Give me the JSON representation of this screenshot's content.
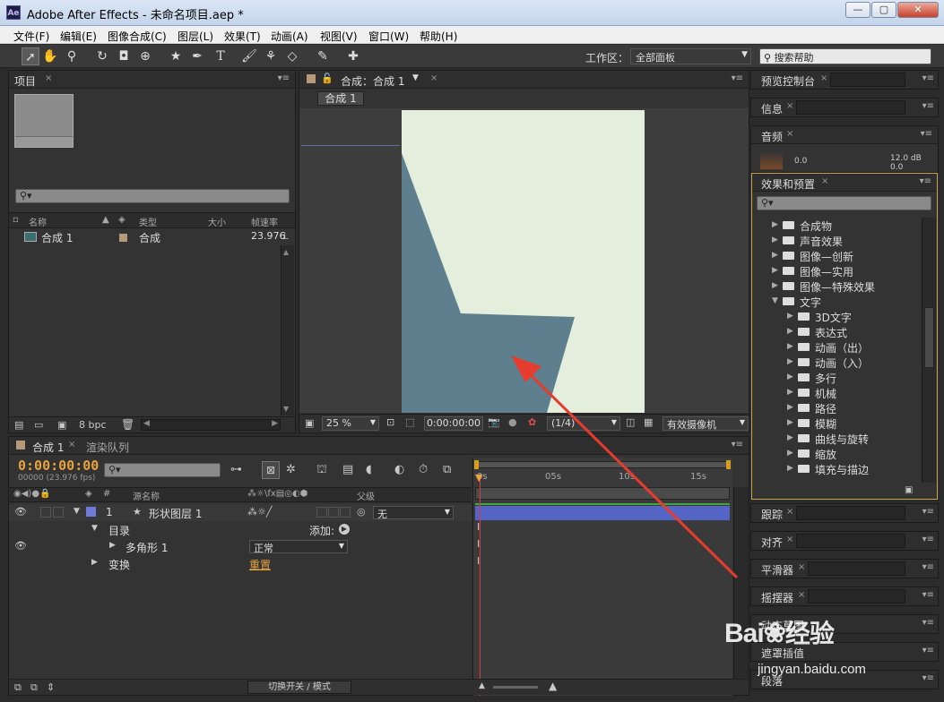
{
  "app": {
    "title": "Adobe After Effects - 未命名项目.aep *",
    "logo": "Ae"
  },
  "window_controls": {
    "minimize": "—",
    "maximize": "▢",
    "close": "✕"
  },
  "menu": [
    "文件(F)",
    "编辑(E)",
    "图像合成(C)",
    "图层(L)",
    "效果(T)",
    "动画(A)",
    "视图(V)",
    "窗口(W)",
    "帮助(H)"
  ],
  "toolbar": {
    "tools": [
      "selection-tool",
      "hand-tool",
      "zoom-tool",
      "rotation-tool",
      "camera-tool",
      "pan-behind-tool",
      "pen-star-tool",
      "pen-tool",
      "text-tool",
      "brush-tool",
      "clone-stamp-tool",
      "eraser-tool",
      "roto-brush-tool",
      "puppet-pin-tool"
    ],
    "workspace_label": "工作区：",
    "workspace_value": "全部面板",
    "help_search": "搜索帮助"
  },
  "project_panel": {
    "tab": "项目",
    "columns": {
      "name": "名称",
      "type": "类型",
      "size": "大小",
      "fps": "帧速率"
    },
    "items": [
      {
        "name": "合成 1",
        "type": "合成",
        "fps": "23.976"
      }
    ],
    "bpc": "8 bpc"
  },
  "comp_panel": {
    "tab": "合成：合成 1",
    "subtab": "合成 1",
    "zoom": "25 %",
    "timecode": "0:00:00:00",
    "resolution": "(1/4)",
    "camera": "有效摄像机",
    "canvas_bg": "#e3eedc",
    "shape_color": "#5e7f8d"
  },
  "timeline": {
    "tab": "合成 1",
    "render_tab": "渲染队列",
    "timecode": "0:00:00:00",
    "fps_info": "00000 (23.976 fps)",
    "header": {
      "num": "#",
      "source": "源名称",
      "parent": "父级"
    },
    "layers": [
      {
        "num": "1",
        "name": "形状图层 1",
        "parent": "无"
      }
    ],
    "contents_label": "目录",
    "add_label": "添加:",
    "polygon_label": "多角形 1",
    "blend_mode": "正常",
    "transform_label": "变换",
    "reset_label": "重置",
    "ruler": [
      "0s",
      "05s",
      "10s",
      "15s"
    ],
    "footer_label": "切换开关 / 模式"
  },
  "right_panels": {
    "preview": "预览控制台",
    "info": "信息",
    "audio": "音频",
    "audio_values": {
      "left": "0.0",
      "right": "12.0 dB",
      "right2": "0.0"
    },
    "effects": "效果和预置",
    "effects_tree": [
      {
        "label": "合成物",
        "level": 0,
        "open": false
      },
      {
        "label": "声音效果",
        "level": 0,
        "open": false
      },
      {
        "label": "图像—创新",
        "level": 0,
        "open": false
      },
      {
        "label": "图像—实用",
        "level": 0,
        "open": false
      },
      {
        "label": "图像—特殊效果",
        "level": 0,
        "open": false
      },
      {
        "label": "文字",
        "level": 0,
        "open": true
      },
      {
        "label": "3D文字",
        "level": 1,
        "open": false
      },
      {
        "label": "表达式",
        "level": 1,
        "open": false
      },
      {
        "label": "动画（出）",
        "level": 1,
        "open": false
      },
      {
        "label": "动画（入）",
        "level": 1,
        "open": false
      },
      {
        "label": "多行",
        "level": 1,
        "open": false
      },
      {
        "label": "机械",
        "level": 1,
        "open": false
      },
      {
        "label": "路径",
        "level": 1,
        "open": false
      },
      {
        "label": "模糊",
        "level": 1,
        "open": false
      },
      {
        "label": "曲线与旋转",
        "level": 1,
        "open": false
      },
      {
        "label": "缩放",
        "level": 1,
        "open": false
      },
      {
        "label": "填充与描边",
        "level": 1,
        "open": false
      }
    ],
    "lower": [
      "跟踪",
      "对齐",
      "平滑器",
      "摇摆器",
      "动态草图",
      "遮罩插值",
      "段落"
    ]
  },
  "watermark": {
    "brand": "Bai",
    "brand2": "经验",
    "url": "jingyan.baidu.com"
  }
}
